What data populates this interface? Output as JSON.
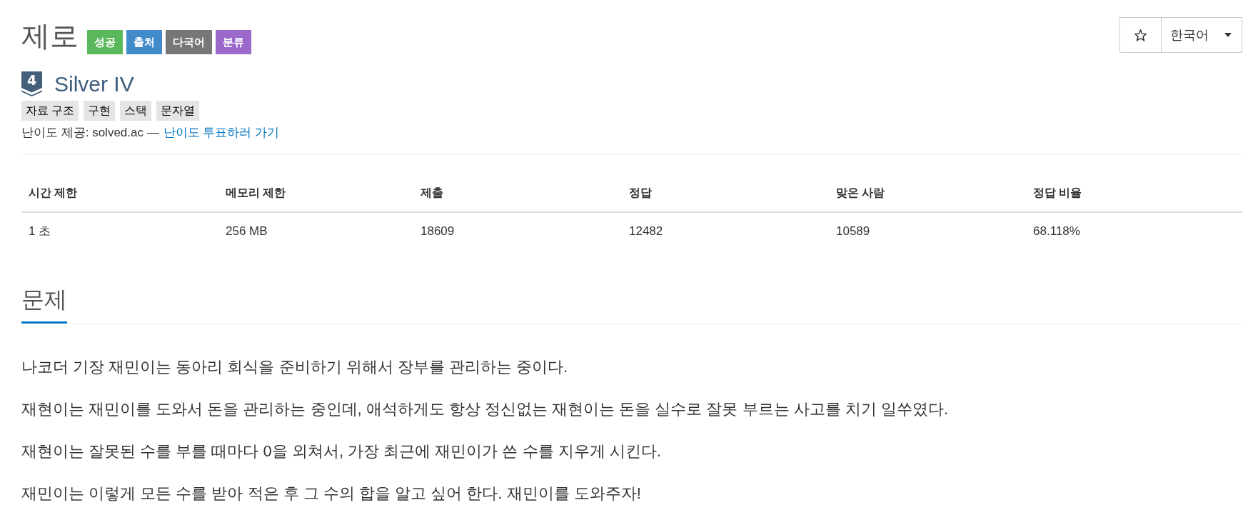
{
  "problem": {
    "title": "제로",
    "badges": [
      {
        "label": "성공",
        "color": "#5cb85c"
      },
      {
        "label": "출처",
        "color": "#428bca"
      },
      {
        "label": "다국어",
        "color": "#777777"
      },
      {
        "label": "분류",
        "color": "#9b69cc"
      }
    ]
  },
  "actions": {
    "language": "한국어"
  },
  "tier": {
    "number": "4",
    "name": "Silver IV"
  },
  "tags": [
    "자료 구조",
    "구현",
    "스택",
    "문자열"
  ],
  "credit": {
    "text": "난이도 제공: solved.ac —",
    "link": "난이도 투표하러 가기"
  },
  "table": {
    "columns": [
      "시간 제한",
      "메모리 제한",
      "제출",
      "정답",
      "맞은 사람",
      "정답 비율"
    ],
    "rows": [
      [
        "1 초",
        "256 MB",
        "18609",
        "12482",
        "10589",
        "68.118%"
      ]
    ]
  },
  "section": {
    "heading": "문제",
    "paragraphs": [
      "나코더 기장 재민이는 동아리 회식을 준비하기 위해서 장부를 관리하는 중이다.",
      "재현이는 재민이를 도와서 돈을 관리하는 중인데, 애석하게도 항상 정신없는 재현이는 돈을 실수로 잘못 부르는 사고를 치기 일쑤였다.",
      "재현이는 잘못된 수를 부를 때마다 0을 외쳐서, 가장 최근에 재민이가 쓴 수를 지우게 시킨다.",
      "재민이는 이렇게 모든 수를 받아 적은 후 그 수의 합을 알고 싶어 한다. 재민이를 도와주자!"
    ]
  }
}
